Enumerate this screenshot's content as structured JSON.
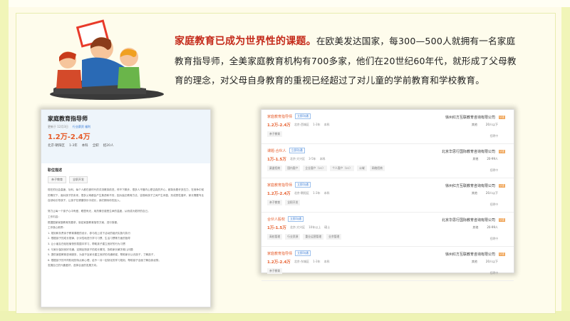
{
  "intro": {
    "highlight": "家庭教育已成为世界性的课题。",
    "body": "在欧美发达国家，每300—500人就拥有一名家庭教育指导师，全美家庭教育机构有700多家，他们在20世纪60年代，就形成了父母教育的理念，对父母自身教育的重视已经超过了对儿童的学前教育和学校教育。"
  },
  "job_detail": {
    "title": "家庭教育指导师",
    "updated": "更新于 12月3日",
    "tag": "行业薪资 福利",
    "salary": "1.2万-2.4万",
    "info": [
      "北京·朝阳区",
      "1-3年",
      "本科",
      "全职",
      "招20人"
    ],
    "section_label": "职位描述",
    "tags": [
      "亲子教育",
      "全职开发"
    ],
    "body_lines": [
      "现在的社会高速、功利、每个人都在被时代的洪流裹挟前进，停不下脚步，很多人不管内心是否真的开心，都背负着许多压力，在竞争中前进",
      "的情况下，面对孩子的未来，很多父母都会产生焦虑和不安，因为缺乏教育方法，容易和孩子之间产生矛盾，形成恶性循环，家长需要专业",
      "自然地引导孩子，让孩子在健康快乐中成长，我们期待你的加入。",
      "",
      "努力让每一个孩子心中有爱、眼里有光，用热情去感受生命的温度，从而成为更好的自己。",
      "工作内容：",
      "根据国家家庭教育的要求，制定家庭教育指导方案，进行授课。",
      "工作核心职责：",
      "1. 规划和负责亲子教育课程的设计，参与线上线下活动的组织实施与执行",
      "2. 根据孩子的成长规律，针对性地进行学习习惯、生活习惯等方面的指导",
      "3. 让小朋友在轻松愉快的氛围中学习，帮助孩子建立良好的行为习惯",
      "4. 与家长保持良好沟通，定期反馈孩子的成长情况，协助家长解决育儿问题",
      "5. 提供家庭教育咨询服务，为孩子及家长建立良好的沟通桥梁，帮助家长认识孩子，了解孩子，",
      "6. 根据孩子的不同阶段的特点和心理，给予一对一定制化的学习规划，帮助孩子全面了解自我优势。",
      "发展自己的兴趣爱好，选择合适的发展方向。"
    ]
  },
  "job_list": [
    {
      "title": "家庭教育指导师",
      "chat": "立即沟通",
      "salary": "1.2万-2.4万",
      "reqs": [
        "北京·西城区",
        "1-3年",
        "本科"
      ],
      "company": "徐州红方互联教育咨询有限公司",
      "badge": "认证",
      "right": [
        "其他",
        "20人以下"
      ],
      "tags": [
        "亲子教育"
      ],
      "contact": "招聘中"
    },
    {
      "title": "课题·合伙人",
      "chat": "立即沟通",
      "salary": "1万-1.5万",
      "reqs": [
        "北京·大兴区",
        "3-5年",
        "本科"
      ],
      "company": "北京华思行国际教育咨询有限公司",
      "badge": "认证",
      "right": [
        "其他",
        "20-99人"
      ],
      "tags": [
        "渠道招商",
        "国内客户",
        "企业客户（2C）",
        "个人客户（2C）",
        "公域",
        "网络招商"
      ],
      "contact": "招聘中"
    },
    {
      "title": "家庭教育指导师",
      "chat": "立即沟通",
      "salary": "1.2万-2.4万",
      "reqs": [
        "北京·朝阳区",
        "1-3年",
        "本科"
      ],
      "company": "徐州红方互联教育咨询有限公司",
      "badge": "认证",
      "right": [
        "其他",
        "20人以下"
      ],
      "tags": [
        "亲子教育",
        "全职开发"
      ],
      "contact": "招聘中"
    },
    {
      "title": "合伙人股权",
      "chat": "立即沟通",
      "salary": "1万-1.5万",
      "reqs": [
        "北京·大兴区",
        "10年以上",
        "硕士"
      ],
      "company": "北京华思行国际教育咨询有限公司",
      "badge": "认证",
      "right": [
        "其他",
        "20-99人"
      ],
      "tags": [
        "高校管理",
        "行业资源",
        "重业运营管理",
        "业余管理"
      ],
      "contact": "招聘中"
    },
    {
      "title": "家庭教育指导师",
      "chat": "立即沟通",
      "salary": "1.2万-2.4万",
      "reqs": [
        "北京·东城区",
        "1-3年",
        "本科"
      ],
      "company": "徐州红方互联教育咨询有限公司",
      "badge": "认证",
      "right": [
        "其他",
        "20人以下"
      ],
      "tags": [
        "亲子教育"
      ],
      "contact": "招聘中"
    }
  ]
}
